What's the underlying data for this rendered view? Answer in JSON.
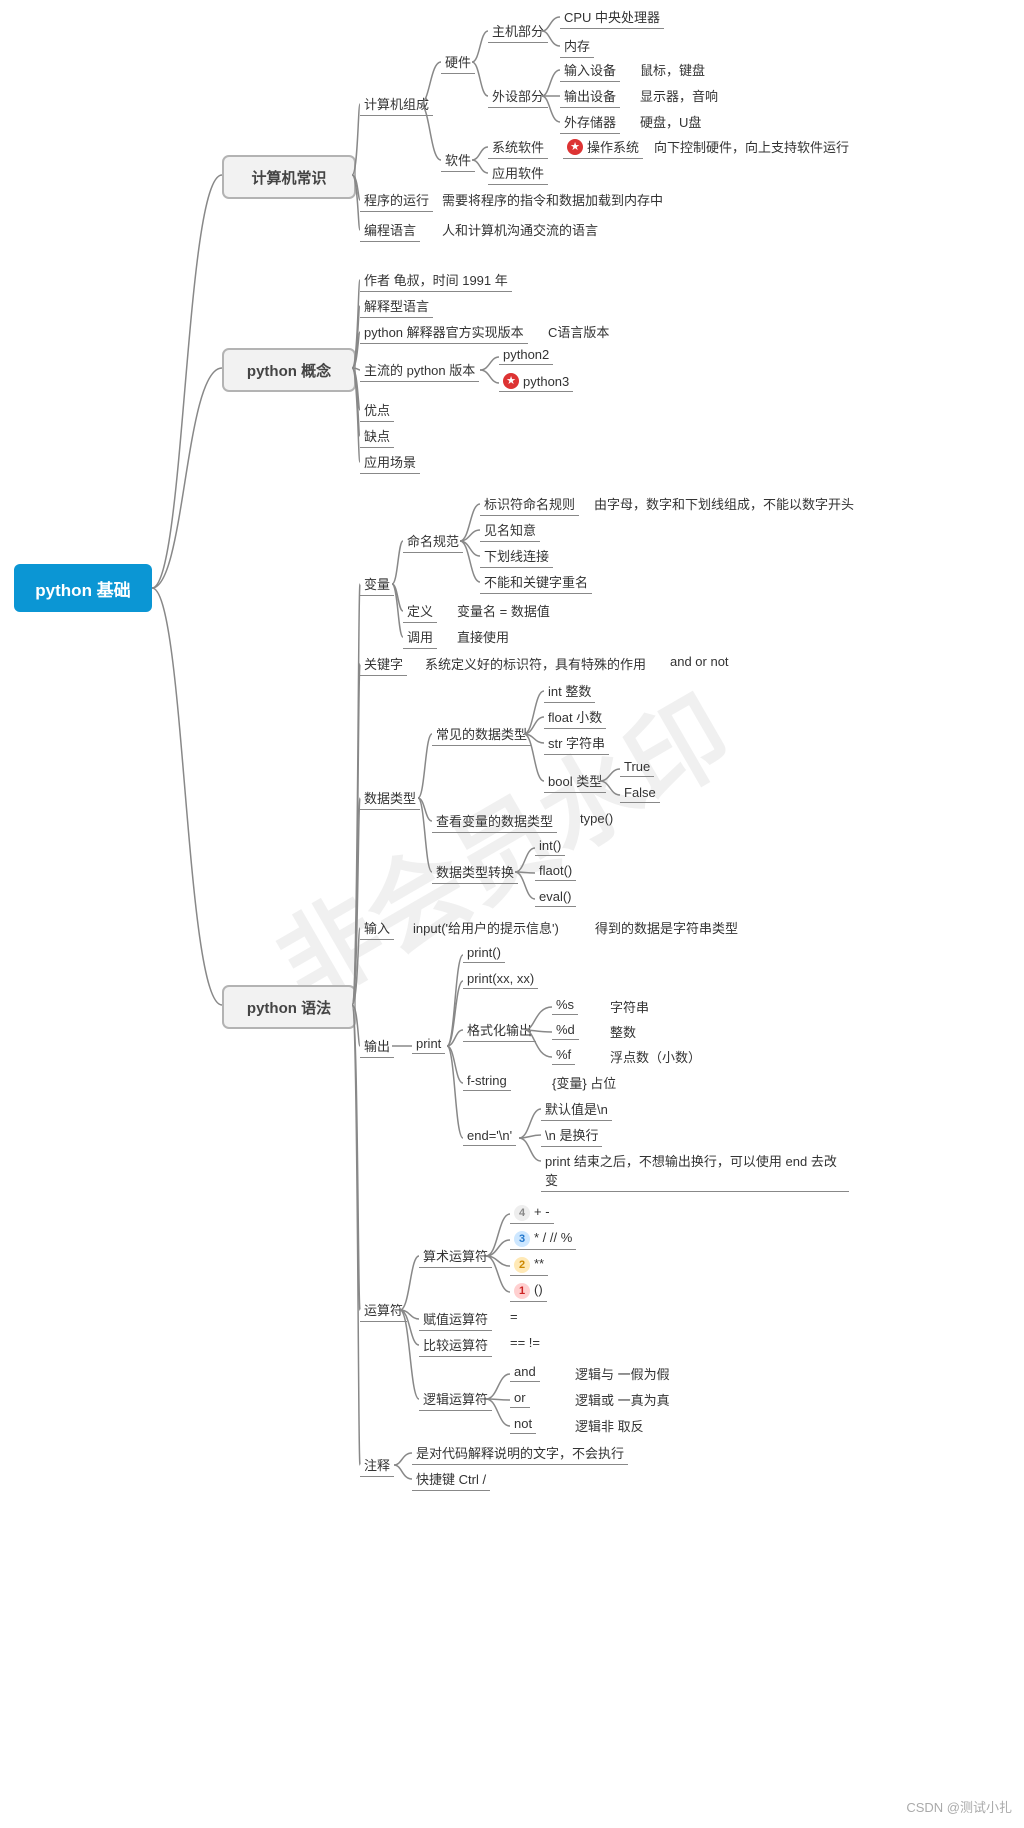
{
  "root": "python 基础",
  "majors": {
    "m1": "计算机常识",
    "m2": "python 概念",
    "m3": "python 语法"
  },
  "n": {
    "c_arch": "计算机组成",
    "c_hw": "硬件",
    "c_main": "主机部分",
    "c_cpu": "CPU 中央处理器",
    "c_mem": "内存",
    "c_peri": "外设部分",
    "c_in": "输入设备",
    "c_in_e": "鼠标，键盘",
    "c_out": "输出设备",
    "c_out_e": "显示器，音响",
    "c_ext": "外存储器",
    "c_ext_e": "硬盘，U盘",
    "c_sw": "软件",
    "c_sys": "系统软件",
    "c_os": "操作系统",
    "c_os_d": "向下控制硬件，向上支持软件运行",
    "c_app": "应用软件",
    "c_run": "程序的运行",
    "c_run_d": "需要将程序的指令和数据加载到内存中",
    "c_lang": "编程语言",
    "c_lang_d": "人和计算机沟通交流的语言",
    "p_auth": "作者 龟叔，时间 1991 年",
    "p_int": "解释型语言",
    "p_impl": "python 解释器官方实现版本",
    "p_impl_d": "C语言版本",
    "p_ver": "主流的 python 版本",
    "p_v2": "python2",
    "p_v3": "python3",
    "p_adv": "优点",
    "p_dis": "缺点",
    "p_use": "应用场景",
    "s_var": "变量",
    "s_name": "命名规范",
    "s_id": "标识符命名规则",
    "s_id_d": "由字母，数字和下划线组成，不能以数字开头",
    "s_mn": "见名知意",
    "s_us": "下划线连接",
    "s_nk": "不能和关键字重名",
    "s_def": "定义",
    "s_def_d": "变量名 = 数据值",
    "s_call": "调用",
    "s_call_d": "直接使用",
    "s_kw": "关键字",
    "s_kw_d": "系统定义好的标识符，具有特殊的作用",
    "s_kw_e": "and  or  not",
    "s_dt": "数据类型",
    "s_cdt": "常见的数据类型",
    "s_int": "int 整数",
    "s_float": "float 小数",
    "s_str": "str  字符串",
    "s_bool": "bool 类型",
    "s_true": "True",
    "s_false": "False",
    "s_chk": "查看变量的数据类型",
    "s_type": "type()",
    "s_conv": "数据类型转换",
    "s_i": "int()",
    "s_f": "flaot()",
    "s_e": "eval()",
    "s_inp": "输入",
    "s_inp_c": "input('给用户的提示信息')",
    "s_inp_d": "得到的数据是字符串类型",
    "s_outp": "输出",
    "s_print": "print",
    "s_p0": "print()",
    "s_p1": "print(xx, xx)",
    "s_fmt": "格式化输出",
    "s_ps": "%s",
    "s_ps_d": "字符串",
    "s_pd": "%d",
    "s_pd_d": "整数",
    "s_pf": "%f",
    "s_pf_d": "浮点数（小数）",
    "s_fs": "f-string",
    "s_fs_d": "{变量} 占位",
    "s_end": "end='\\n'",
    "s_e1": "默认值是\\n",
    "s_e2": "\\n 是换行",
    "s_e3": "print 结束之后，不想输出换行，可以使用 end 去改变",
    "s_op": "运算符",
    "s_ar": "算术运算符",
    "s_a4": "+ -",
    "s_a3": "*  /  //    %",
    "s_a2": "**",
    "s_a1": "()",
    "s_as": "赋值运算符",
    "s_as_d": "=",
    "s_cmp": "比较运算符",
    "s_cmp_d": "==  !=",
    "s_log": "逻辑运算符",
    "s_and": "and",
    "s_and_d": "逻辑与   一假为假",
    "s_or": "or",
    "s_or_d": "逻辑或  一真为真",
    "s_not": "not",
    "s_not_d": "逻辑非  取反",
    "s_cm": "注释",
    "s_cm1": "是对代码解释说明的文字，不会执行",
    "s_cm2": "快捷键 Ctrl /"
  },
  "watermark": "非会员水印",
  "credit": "CSDN @测试小扎"
}
